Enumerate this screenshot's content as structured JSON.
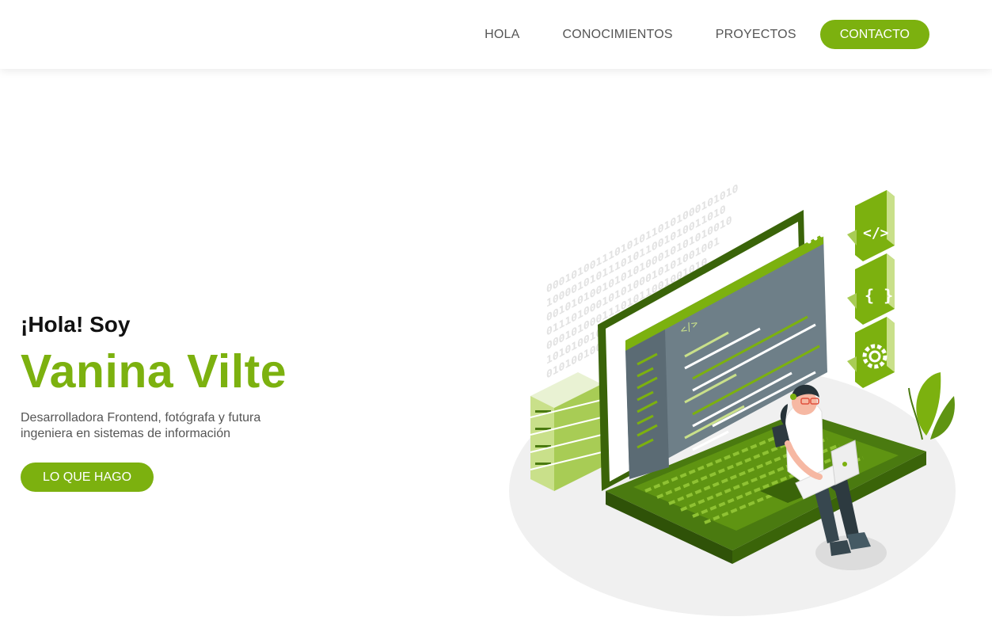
{
  "nav": {
    "items": [
      {
        "label": "HOLA"
      },
      {
        "label": "CONOCIMIENTOS"
      },
      {
        "label": "PROYECTOS"
      }
    ],
    "cta_label": "CONTACTO"
  },
  "hero": {
    "greeting": "¡Hola! Soy",
    "name": "Vanina Vilte",
    "description": "Desarrolladora Frontend, fotógrafa y futura ingeniera en sistemas de información",
    "button_label": "LO QUE HAGO"
  },
  "illustration": {
    "binary_lines": [
      "0001010011101010110101000101010",
      "10000101011101011001010011010",
      "001010100101010100010101010010",
      "0111010001010100010101001001",
      "00010100011101011001001010",
      "1010100100101010010101",
      "0101001001010010"
    ],
    "code_tag": "</>",
    "braces": "{ }",
    "icons": [
      "code-icon",
      "braces-icon",
      "gear-icon"
    ]
  },
  "colors": {
    "accent": "#7cb10f",
    "accent_dark": "#4a7a10",
    "accent_light": "#c9e08a",
    "text": "#555555",
    "heading": "#111111"
  }
}
